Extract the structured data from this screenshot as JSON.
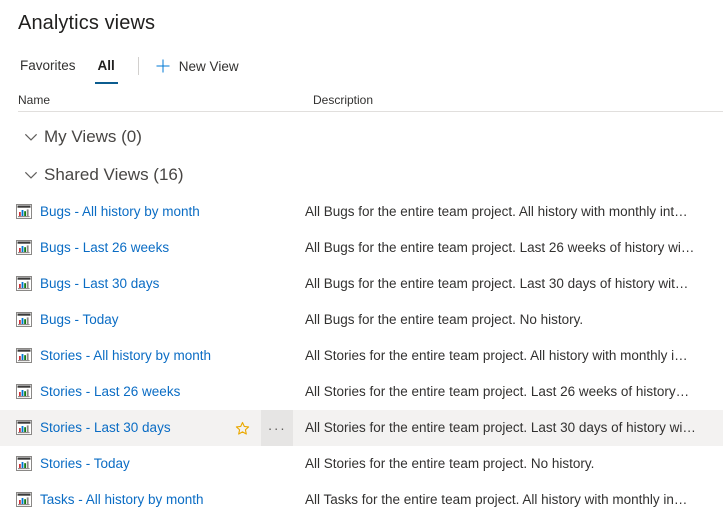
{
  "header": {
    "title": "Analytics views"
  },
  "command_bar": {
    "tabs": [
      {
        "label": "Favorites",
        "active": false
      },
      {
        "label": "All",
        "active": true
      }
    ],
    "new_view_label": "New View",
    "plus_icon": "plus-icon",
    "accent_color": "#0078d4",
    "active_tab_underline_color": "#0b5c8f"
  },
  "columns": {
    "name": "Name",
    "description": "Description"
  },
  "groups": [
    {
      "label": "My Views (0)",
      "chevron_icon": "chevron-down-icon",
      "rows": []
    },
    {
      "label": "Shared Views (16)",
      "chevron_icon": "chevron-down-icon",
      "rows": [
        {
          "icon": "analytics-view-icon",
          "name": "Bugs - All history by month",
          "description": "All Bugs for the entire team project. All history with monthly int…",
          "hovered": false
        },
        {
          "icon": "analytics-view-icon",
          "name": "Bugs - Last 26 weeks",
          "description": "All Bugs for the entire team project. Last 26 weeks of history wi…",
          "hovered": false
        },
        {
          "icon": "analytics-view-icon",
          "name": "Bugs - Last 30 days",
          "description": "All Bugs for the entire team project. Last 30 days of history wit…",
          "hovered": false
        },
        {
          "icon": "analytics-view-icon",
          "name": "Bugs - Today",
          "description": "All Bugs for the entire team project. No history.",
          "hovered": false
        },
        {
          "icon": "analytics-view-icon",
          "name": "Stories - All history by month",
          "description": "All Stories for the entire team project. All history with monthly i…",
          "hovered": false
        },
        {
          "icon": "analytics-view-icon",
          "name": "Stories - Last 26 weeks",
          "description": "All Stories for the entire team project. Last 26 weeks of history…",
          "hovered": false
        },
        {
          "icon": "analytics-view-icon",
          "name": "Stories - Last 30 days",
          "description": "All Stories for the entire team project. Last 30 days of history wi…",
          "hovered": true,
          "actions": {
            "favorite_icon": "star-outline-icon",
            "favorite_color": "#eba900",
            "more_label": "···",
            "more_icon": "ellipsis-icon"
          }
        },
        {
          "icon": "analytics-view-icon",
          "name": "Stories - Today",
          "description": "All Stories for the entire team project. No history.",
          "hovered": false
        },
        {
          "icon": "analytics-view-icon",
          "name": "Tasks - All history by month",
          "description": "All Tasks for the entire team project. All history with monthly in…",
          "hovered": false
        }
      ]
    }
  ]
}
